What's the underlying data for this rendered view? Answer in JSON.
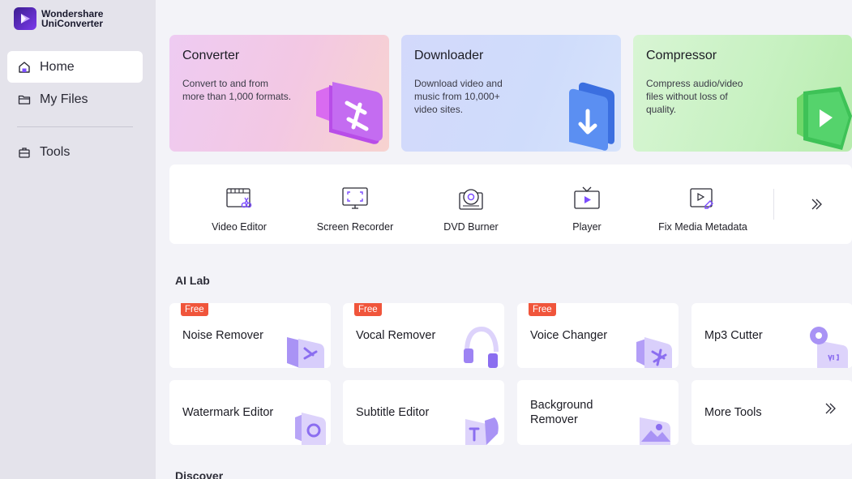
{
  "app": {
    "brand_line1": "Wondershare",
    "brand_line2": "UniConverter"
  },
  "sidebar": {
    "items": [
      {
        "label": "Home",
        "icon": "home-icon",
        "active": true
      },
      {
        "label": "My Files",
        "icon": "folder-icon",
        "active": false
      },
      {
        "label": "Tools",
        "icon": "toolbox-icon",
        "active": false
      }
    ]
  },
  "features": [
    {
      "title": "Converter",
      "desc": "Convert to and from more than 1,000 formats."
    },
    {
      "title": "Downloader",
      "desc": "Download video and music from 10,000+ video sites."
    },
    {
      "title": "Compressor",
      "desc": "Compress audio/video files without loss of quality."
    }
  ],
  "tools": [
    {
      "label": "Video Editor",
      "icon": "video-editor-icon"
    },
    {
      "label": "Screen Recorder",
      "icon": "screen-recorder-icon"
    },
    {
      "label": "DVD Burner",
      "icon": "dvd-burner-icon"
    },
    {
      "label": "Player",
      "icon": "player-icon"
    },
    {
      "label": "Fix Media Metadata",
      "icon": "media-metadata-icon"
    }
  ],
  "ai_lab": {
    "title": "AI Lab",
    "cards": [
      {
        "label": "Noise Remover",
        "badge": "Free"
      },
      {
        "label": "Vocal Remover",
        "badge": "Free"
      },
      {
        "label": "Voice Changer",
        "badge": "Free"
      },
      {
        "label": "Mp3 Cutter",
        "badge": ""
      },
      {
        "label": "Watermark Editor",
        "badge": ""
      },
      {
        "label": "Subtitle Editor",
        "badge": ""
      },
      {
        "label": "Background Remover",
        "badge": ""
      },
      {
        "label": "More Tools",
        "badge": ""
      }
    ]
  },
  "discover": {
    "title": "Discover"
  },
  "colors": {
    "accent": "#7c4dff",
    "badge": "#f0553b",
    "sidebar_bg": "#e4e3eb",
    "main_bg": "#f3f3f8"
  }
}
